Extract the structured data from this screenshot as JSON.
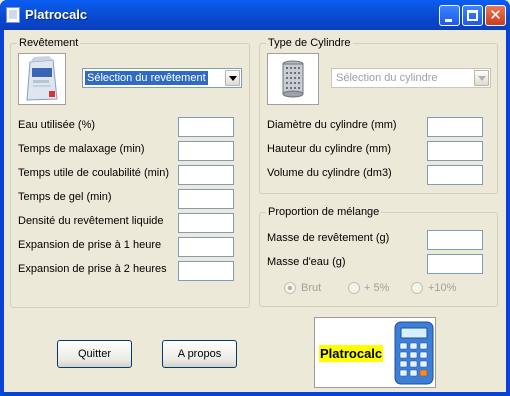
{
  "window": {
    "title": "Platrocalc"
  },
  "revetement": {
    "legend": "Revêtement",
    "select": "Sélection du revêtement",
    "fields": [
      "Eau utilisée (%)",
      "Temps de malaxage (min)",
      "Temps utile de coulabilité (min)",
      "Temps de gel (min)",
      "Densité du revêtement liquide",
      "Expansion de prise à 1 heure",
      "Expansion de prise à 2 heures"
    ]
  },
  "cylindre": {
    "legend": "Type de Cylindre",
    "select": "Sélection du cylindre",
    "fields": [
      "Diamètre du cylindre (mm)",
      "Hauteur du cylindre (mm)",
      "Volume du cylindre (dm3)"
    ]
  },
  "melange": {
    "legend": "Proportion de mélange",
    "fields": [
      "Masse de revêtement (g)",
      "Masse d'eau (g)"
    ],
    "options": [
      {
        "label": "Brut",
        "checked": true
      },
      {
        "label": "+ 5%",
        "checked": false
      },
      {
        "label": "+10%",
        "checked": false
      }
    ]
  },
  "buttons": {
    "quit": "Quitter",
    "about": "A propos"
  },
  "logo": {
    "text": "Platrocalc"
  }
}
